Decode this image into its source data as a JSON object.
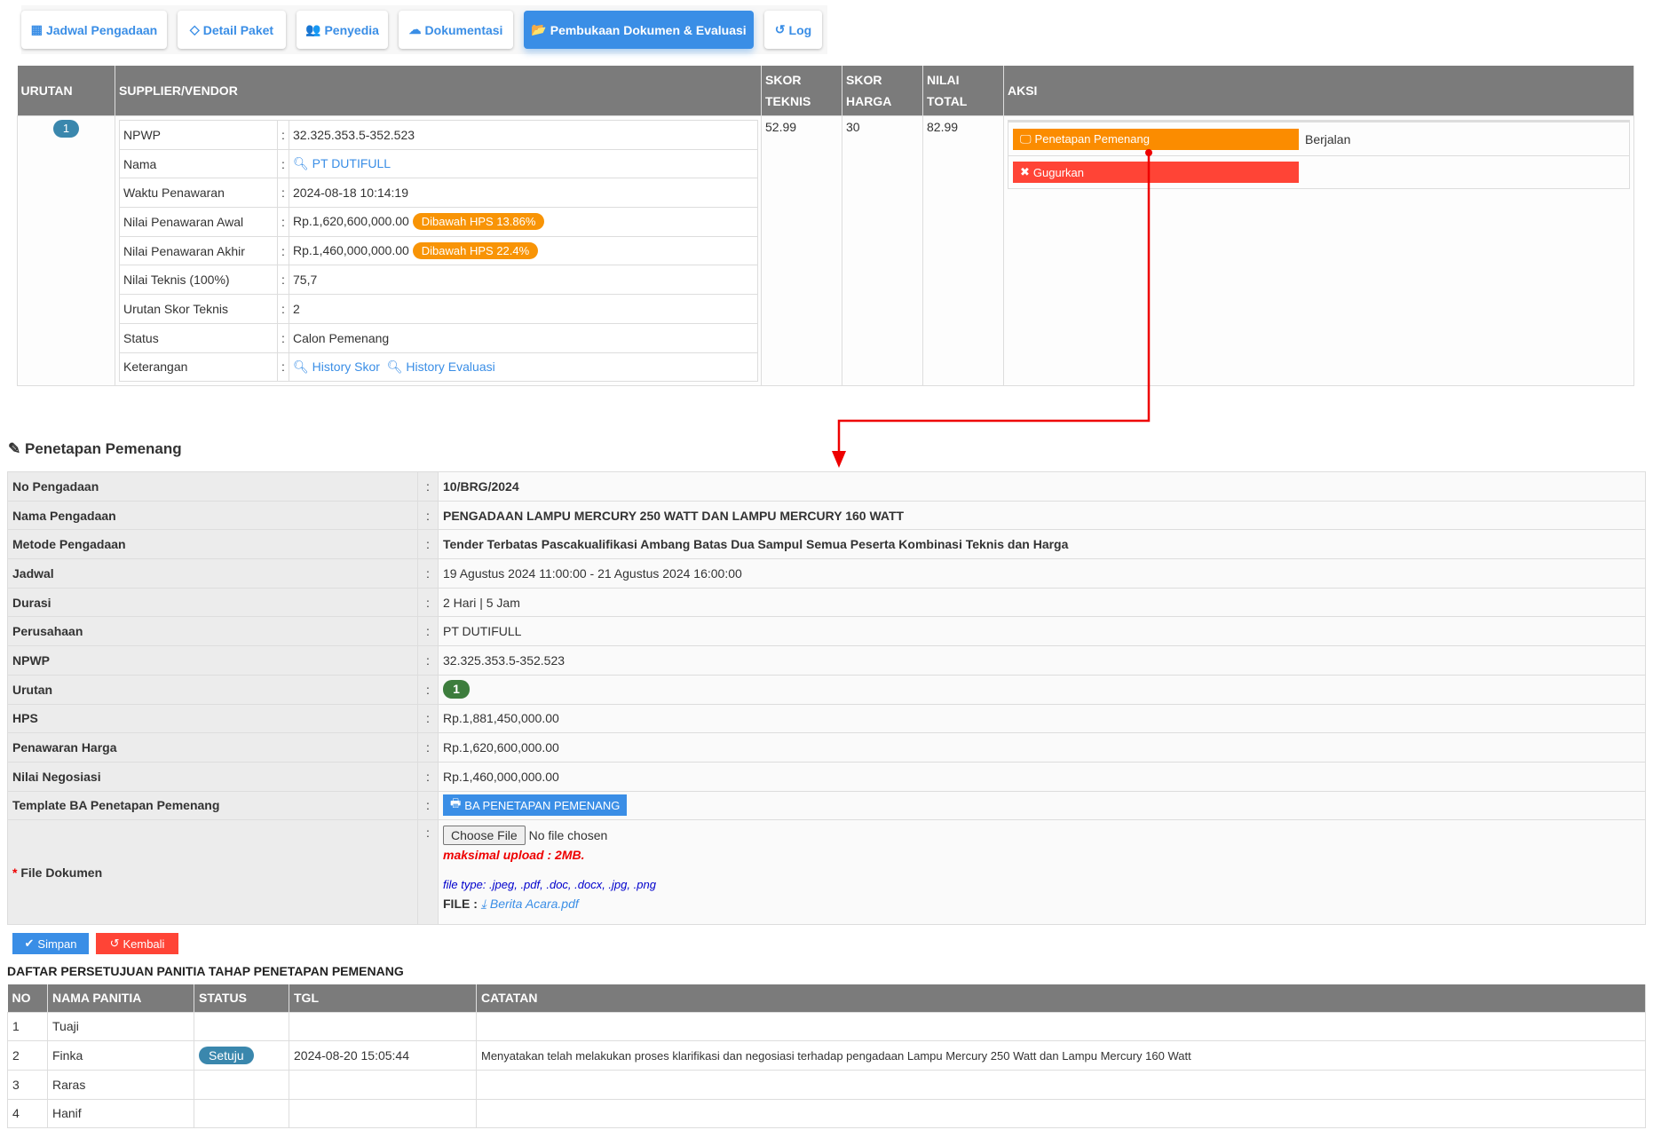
{
  "tabs": [
    {
      "label": "Jadwal Pengadaan",
      "icon": "calendar-icon"
    },
    {
      "label": "Detail Paket",
      "icon": "diamond-icon"
    },
    {
      "label": "Penyedia",
      "icon": "users-icon"
    },
    {
      "label": "Dokumentasi",
      "icon": "cloud-upload-icon"
    },
    {
      "label": "Pembukaan Dokumen & Evaluasi",
      "icon": "folder-open-icon",
      "active": true
    },
    {
      "label": "Log",
      "icon": "history-icon"
    }
  ],
  "evaluation": {
    "headers": {
      "urutan": "URUTAN",
      "supplier": "SUPPLIER/VENDOR",
      "skor_teknis_1": "SKOR",
      "skor_teknis_2": "TEKNIS",
      "skor_harga_1": "SKOR",
      "skor_harga_2": "HARGA",
      "nilai_total_1": "NILAI",
      "nilai_total_2": "TOTAL",
      "aksi": "AKSI"
    },
    "urutan": "1",
    "skor_teknis": "52.99",
    "skor_harga": "30",
    "nilai_total": "82.99",
    "details": [
      {
        "label": "NPWP",
        "value": "32.325.353.5-352.523"
      },
      {
        "label": "Nama",
        "value": "PT DUTIFULL"
      },
      {
        "label": "Waktu Penawaran",
        "value": "2024-08-18 10:14:19"
      },
      {
        "label": "Nilai Penawaran Awal",
        "value": "Rp.1,620,600,000.00",
        "badge": "Dibawah HPS 13.86%"
      },
      {
        "label": "Nilai Penawaran Akhir",
        "value": "Rp.1,460,000,000.00",
        "badge": "Dibawah HPS 22.4%"
      },
      {
        "label": "Nilai Teknis (100%)",
        "value": "75,7"
      },
      {
        "label": "Urutan Skor Teknis",
        "value": "2"
      },
      {
        "label": "Status",
        "value": "Calon Pemenang"
      },
      {
        "label": "Keterangan",
        "link1": "History Skor",
        "link2": "History Evaluasi"
      }
    ],
    "colon": ":",
    "actions": {
      "penetapan": "Penetapan Pemenang",
      "status": "Berjalan",
      "gugurkan": "Gugurkan"
    }
  },
  "penetapan": {
    "title": "Penetapan Pemenang",
    "rows": [
      {
        "label": "No Pengadaan",
        "value": "10/BRG/2024"
      },
      {
        "label": "Nama Pengadaan",
        "value": "PENGADAAN LAMPU MERCURY 250 WATT DAN LAMPU MERCURY 160 WATT"
      },
      {
        "label": "Metode Pengadaan",
        "value": "Tender Terbatas Pascakualifikasi Ambang Batas Dua Sampul Semua Peserta Kombinasi Teknis dan Harga"
      },
      {
        "label": "Jadwal",
        "value": "19 Agustus 2024 11:00:00 - 21 Agustus 2024 16:00:00"
      },
      {
        "label": "Durasi",
        "value": "2 Hari | 5 Jam"
      },
      {
        "label": "Perusahaan",
        "value": "PT DUTIFULL"
      },
      {
        "label": "NPWP",
        "value": "32.325.353.5-352.523"
      },
      {
        "label": "Urutan",
        "value": "1"
      },
      {
        "label": "HPS",
        "value": "Rp.1,881,450,000.00"
      },
      {
        "label": "Penawaran Harga",
        "value": "Rp.1,620,600,000.00"
      },
      {
        "label": "Nilai Negosiasi",
        "value": "Rp.1,460,000,000.00"
      },
      {
        "label": "Template BA Penetapan Pemenang",
        "value": "BA PENETAPAN PEMENANG"
      }
    ],
    "file": {
      "label": "File Dokumen",
      "required": "*",
      "choose": "Choose File",
      "no_file": "No file chosen",
      "max": "maksimal upload : 2MB.",
      "types": "file type: .jpeg, .pdf, .doc, .docx, .jpg, .png",
      "file_label": "FILE :",
      "file_name": "Berita Acara.pdf"
    },
    "simpan": "Simpan",
    "kembali": "Kembali"
  },
  "approval": {
    "title": "DAFTAR PERSETUJUAN PANITIA TAHAP PENETAPAN PEMENANG",
    "headers": [
      "NO",
      "NAMA PANITIA",
      "STATUS",
      "TGL",
      "CATATAN"
    ],
    "rows": [
      {
        "no": "1",
        "nama": "Tuaji",
        "status": "",
        "tgl": "",
        "catatan": ""
      },
      {
        "no": "2",
        "nama": "Finka",
        "status": "Setuju",
        "tgl": "2024-08-20 15:05:44",
        "catatan": "Menyatakan telah melakukan proses klarifikasi dan negosiasi terhadap pengadaan Lampu Mercury 250 Watt dan Lampu Mercury 160 Watt"
      },
      {
        "no": "3",
        "nama": "Raras",
        "status": "",
        "tgl": "",
        "catatan": ""
      },
      {
        "no": "4",
        "nama": "Hanif",
        "status": "",
        "tgl": "",
        "catatan": ""
      }
    ]
  },
  "colors": {
    "primary": "#3a8ee6",
    "orange": "#fb8c00",
    "red": "#ff4436",
    "header": "#7b7b7b",
    "badge": "#3a87ad",
    "green": "#3d7d3d"
  }
}
